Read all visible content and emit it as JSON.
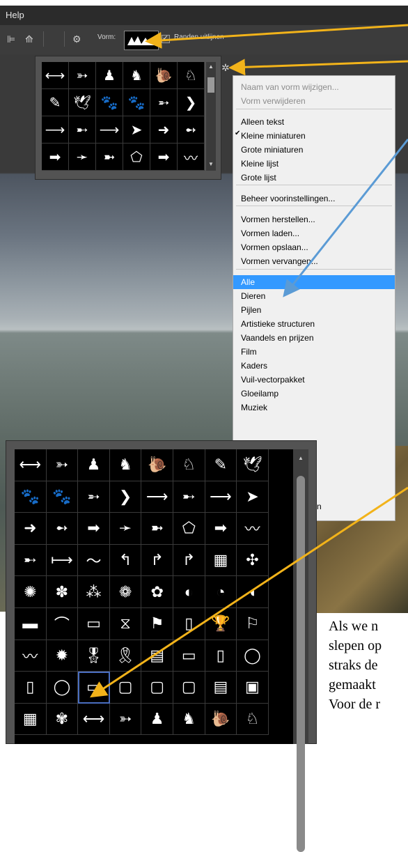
{
  "menubar": {
    "help": "Help"
  },
  "options_bar": {
    "vorm_label": "Vorm:",
    "randen_label": "Randen uitlijnen",
    "randen_checked": true
  },
  "shape_menu": {
    "items": [
      {
        "label": "Naam van vorm wijzigen...",
        "disabled": true
      },
      {
        "label": "Vorm verwijderen",
        "disabled": true
      },
      {
        "label": "Alleen tekst"
      },
      {
        "label": "Kleine miniaturen",
        "checked": true
      },
      {
        "label": "Grote miniaturen"
      },
      {
        "label": "Kleine lijst"
      },
      {
        "label": "Grote lijst"
      },
      {
        "label": "Beheer voorinstellingen..."
      },
      {
        "label": "Vormen herstellen..."
      },
      {
        "label": "Vormen laden..."
      },
      {
        "label": "Vormen opslaan..."
      },
      {
        "label": "Vormen vervangen..."
      },
      {
        "label": "Alle",
        "selected": true
      },
      {
        "label": "Dieren"
      },
      {
        "label": "Pijlen"
      },
      {
        "label": "Artistieke structuren"
      },
      {
        "label": "Vaandels en prijzen"
      },
      {
        "label": "Film"
      },
      {
        "label": "Kaders"
      },
      {
        "label": "Vuil-vectorpakket"
      },
      {
        "label": "Gloeilamp"
      },
      {
        "label": "Muziek"
      }
    ],
    "tail_fragment": "n"
  },
  "doc_text": [
    "Als we n",
    "slepen op",
    "straks de",
    "gemaakt",
    "Voor de r"
  ],
  "colors": {
    "arrow_yellow": "#f2b31a",
    "arrow_blue": "#5b9bd5",
    "menu_highlight": "#3399ff"
  }
}
